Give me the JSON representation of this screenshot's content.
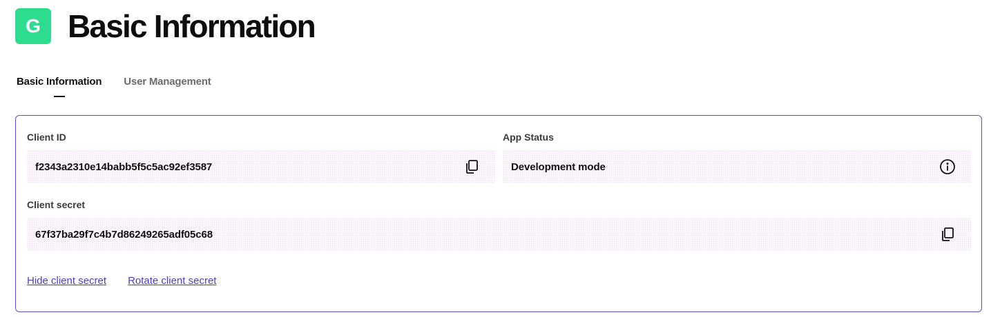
{
  "header": {
    "logo_letter": "G",
    "title": "Basic Information"
  },
  "tabs": [
    {
      "label": "Basic Information",
      "active": true
    },
    {
      "label": "User Management",
      "active": false
    }
  ],
  "card": {
    "client_id": {
      "label": "Client ID",
      "value": "f2343a2310e14babb5f5c5ac92ef3587",
      "icon": "copy-icon"
    },
    "app_status": {
      "label": "App Status",
      "value": "Development mode",
      "icon": "info-icon"
    },
    "client_secret": {
      "label": "Client secret",
      "value": "67f37ba29f7c4b7d86249265adf05c68",
      "icon": "copy-icon"
    },
    "links": {
      "hide_secret": "Hide client secret",
      "rotate_secret": "Rotate client secret"
    }
  },
  "colors": {
    "logo": "#2ddc8e",
    "card_border": "#5b4fd4",
    "link": "#4a3fc9",
    "field_bg": "#fbf5fc"
  }
}
